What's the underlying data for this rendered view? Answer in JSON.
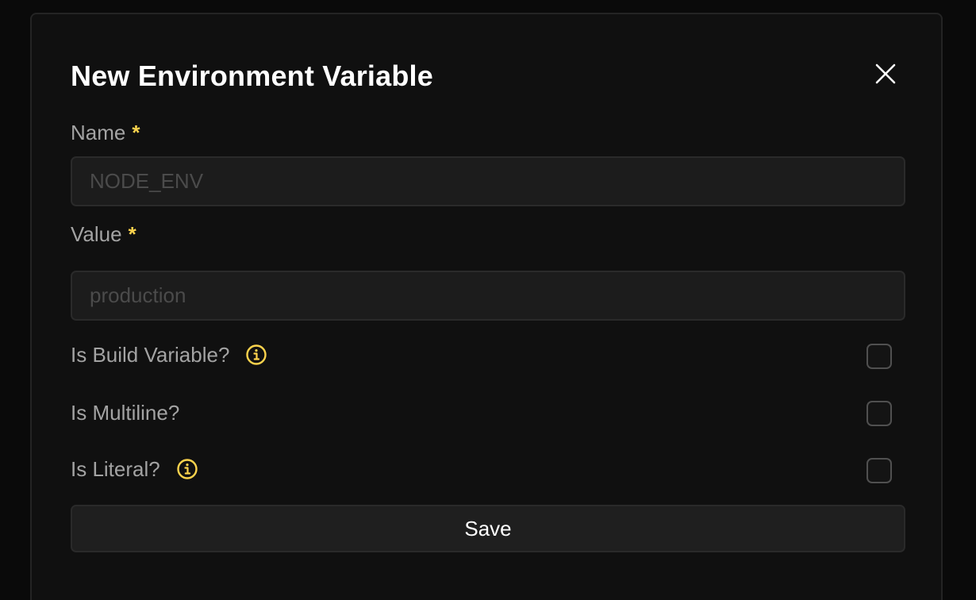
{
  "dialog": {
    "title": "New Environment Variable",
    "close_icon": "close-icon"
  },
  "fields": {
    "name": {
      "label": "Name",
      "required_mark": "*",
      "value": "",
      "placeholder": "NODE_ENV"
    },
    "value": {
      "label": "Value",
      "required_mark": "*",
      "value": "",
      "placeholder": "production"
    }
  },
  "options": [
    {
      "label": "Is Build Variable?",
      "has_info": true,
      "info_icon": "info-icon",
      "checked": false
    },
    {
      "label": "Is Multiline?",
      "has_info": false,
      "checked": false
    },
    {
      "label": "Is Literal?",
      "has_info": true,
      "info_icon": "info-icon",
      "checked": false
    }
  ],
  "actions": {
    "save_label": "Save"
  },
  "colors": {
    "background": "#0a0a0a",
    "modal": "#101010",
    "accent_required": "#fcd34d",
    "info_icon": "#fcd34d",
    "label": "#a3a3a3",
    "input_bg": "#1c1c1c",
    "placeholder": "#4b4b4b"
  }
}
